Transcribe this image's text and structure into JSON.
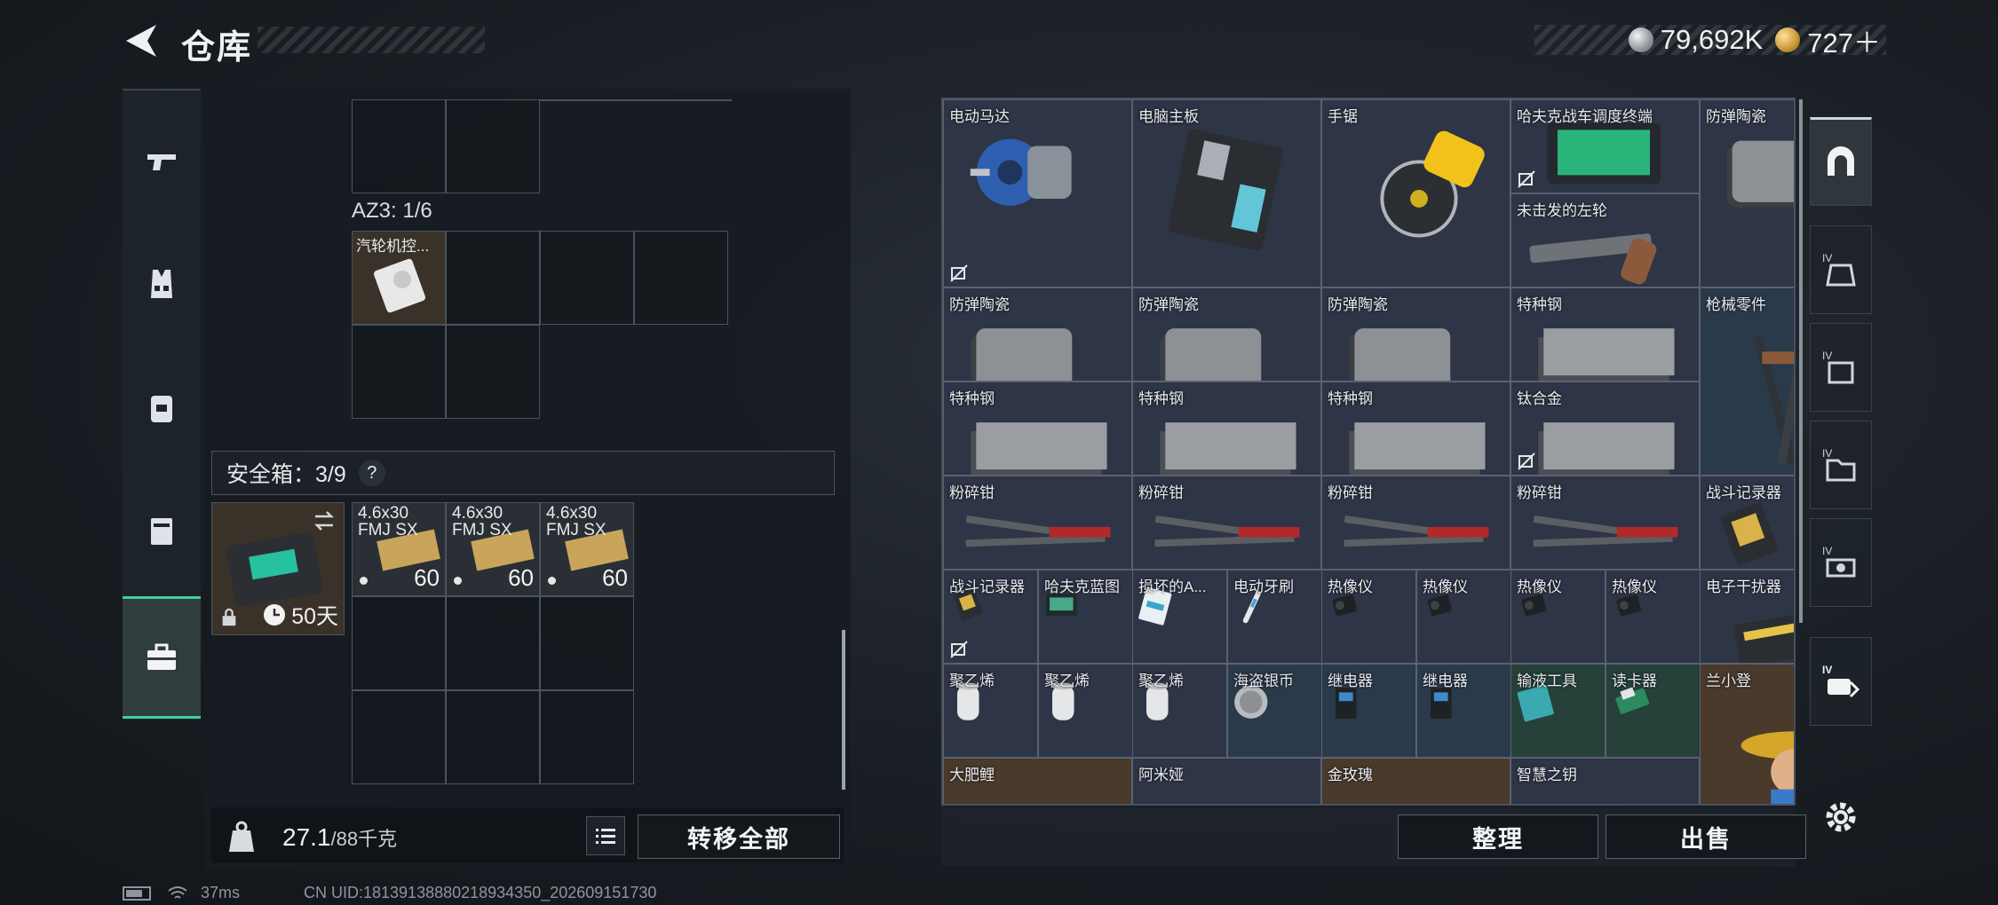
{
  "header": {
    "title": "仓库",
    "currency": [
      {
        "value": "79,692K",
        "icon": "silver-coin-icon"
      },
      {
        "value": "727＋",
        "icon": "gold-coin-icon"
      }
    ]
  },
  "sidenav": {
    "items": [
      {
        "name": "weapon-tab",
        "icon": "pistol-icon"
      },
      {
        "name": "vest-tab",
        "icon": "vest-icon"
      },
      {
        "name": "backpack-tab",
        "icon": "backpack-icon"
      },
      {
        "name": "rig-tab",
        "icon": "chest-rig-icon"
      },
      {
        "name": "safebox-tab",
        "icon": "toolbox-icon",
        "active": true
      }
    ]
  },
  "left_panel": {
    "az_label": "AZ3: 1/6",
    "az_item": "汽轮机控...",
    "safe_label": "安全箱：3/9",
    "help": "?",
    "safebox_timer": "50天",
    "ammo": [
      {
        "name": "4.6x30\nFMJ SX",
        "count": "60"
      },
      {
        "name": "4.6x30\nFMJ SX",
        "count": "60"
      },
      {
        "name": "4.6x30\nFMJ SX",
        "count": "60"
      }
    ],
    "weight_value": "27.1",
    "weight_max": "/88千克",
    "transfer_all": "转移全部"
  },
  "inventory": {
    "items": [
      {
        "name": "电动马达",
        "art": "motor",
        "untradable": true
      },
      {
        "name": "电脑主板",
        "art": "motherboard"
      },
      {
        "name": "手锯",
        "art": "saw"
      },
      {
        "name": "哈夫克战车调度终端",
        "art": "terminal",
        "untradable": true
      },
      {
        "name": "防弹陶瓷",
        "art": "plate"
      },
      {
        "name": "未击发的左轮",
        "art": "revolver"
      },
      {
        "name": "防弹陶瓷",
        "art": "plate"
      },
      {
        "name": "防弹陶瓷",
        "art": "plate"
      },
      {
        "name": "防弹陶瓷",
        "art": "plate"
      },
      {
        "name": "特种钢",
        "art": "steel"
      },
      {
        "name": "枪械零件",
        "art": "gunparts"
      },
      {
        "name": "特种钢",
        "art": "steel"
      },
      {
        "name": "特种钢",
        "art": "steel"
      },
      {
        "name": "特种钢",
        "art": "steel"
      },
      {
        "name": "钛合金",
        "art": "steel",
        "untradable": true
      },
      {
        "name": "粉碎钳",
        "art": "cutter"
      },
      {
        "name": "粉碎钳",
        "art": "cutter"
      },
      {
        "name": "粉碎钳",
        "art": "cutter"
      },
      {
        "name": "粉碎钳",
        "art": "cutter"
      },
      {
        "name": "战斗记录器",
        "art": "recorder"
      },
      {
        "name": "战斗记录器",
        "art": "recorder",
        "untradable": true
      },
      {
        "name": "哈夫克蓝图",
        "art": "blueprint"
      },
      {
        "name": "损坏的A...",
        "art": "card"
      },
      {
        "name": "电动牙刷",
        "art": "toothbrush"
      },
      {
        "name": "热像仪",
        "art": "thermal"
      },
      {
        "name": "热像仪",
        "art": "thermal"
      },
      {
        "name": "热像仪",
        "art": "thermal"
      },
      {
        "name": "热像仪",
        "art": "thermal"
      },
      {
        "name": "电子干扰器",
        "art": "jammer"
      },
      {
        "name": "聚乙烯",
        "art": "roll"
      },
      {
        "name": "聚乙烯",
        "art": "roll"
      },
      {
        "name": "聚乙烯",
        "art": "roll"
      },
      {
        "name": "海盗银币",
        "art": "coin"
      },
      {
        "name": "继电器",
        "art": "relay"
      },
      {
        "name": "继电器",
        "art": "relay"
      },
      {
        "name": "输液工具",
        "art": "board"
      },
      {
        "name": "读卡器",
        "art": "cardreader"
      },
      {
        "name": "兰小登",
        "art": "figure"
      },
      {
        "name": "大肥鲤",
        "art": "fish"
      },
      {
        "name": "阿米娅",
        "art": "figure2"
      },
      {
        "name": "金玫瑰",
        "art": "rose"
      },
      {
        "name": "智慧之钥",
        "art": "key"
      }
    ],
    "arrange": "整理",
    "sell": "出售"
  },
  "rightnav": {
    "items": [
      {
        "name": "stash-tab",
        "icon": "arch-icon"
      },
      {
        "name": "tier4-armor-tab",
        "label": "IV",
        "icon": "armor-icon"
      },
      {
        "name": "tier4-bag-tab",
        "label": "IV",
        "icon": "bag-icon"
      },
      {
        "name": "tier4-folder-tab",
        "label": "IV",
        "icon": "folder-icon"
      },
      {
        "name": "tier4-gear-tab",
        "label": "IV",
        "icon": "gear-box-icon"
      },
      {
        "name": "tier4-ticket-tab",
        "label": "IV",
        "icon": "ticket-icon"
      }
    ]
  },
  "status": {
    "ping": "37ms",
    "uid": "CN UID:18139138880218934350_202609151730"
  },
  "colors": {
    "accent": "#3fcf9e",
    "tile_item": "#3a3228",
    "inventory_bg": "#2e3546"
  }
}
